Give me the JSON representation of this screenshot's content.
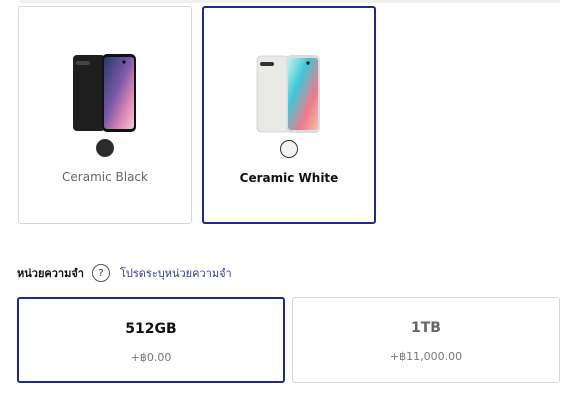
{
  "colors": {
    "items": [
      {
        "label": "Ceramic Black",
        "swatch": "#2a2a2a",
        "selected": false
      },
      {
        "label": "Ceramic White",
        "swatch": "#f4f3ef",
        "selected": true
      }
    ]
  },
  "storage": {
    "title": "หน่วยความจำ",
    "help_icon_glyph": "?",
    "hint": "โปรดระบุหน่วยความจำ",
    "options": [
      {
        "capacity": "512GB",
        "price": "+฿0.00",
        "selected": true
      },
      {
        "capacity": "1TB",
        "price": "+฿11,000.00",
        "selected": false
      }
    ]
  },
  "theme": {
    "accent": "#1d2b8f",
    "link": "#2b3aa8",
    "border": "#d8d8d8"
  }
}
